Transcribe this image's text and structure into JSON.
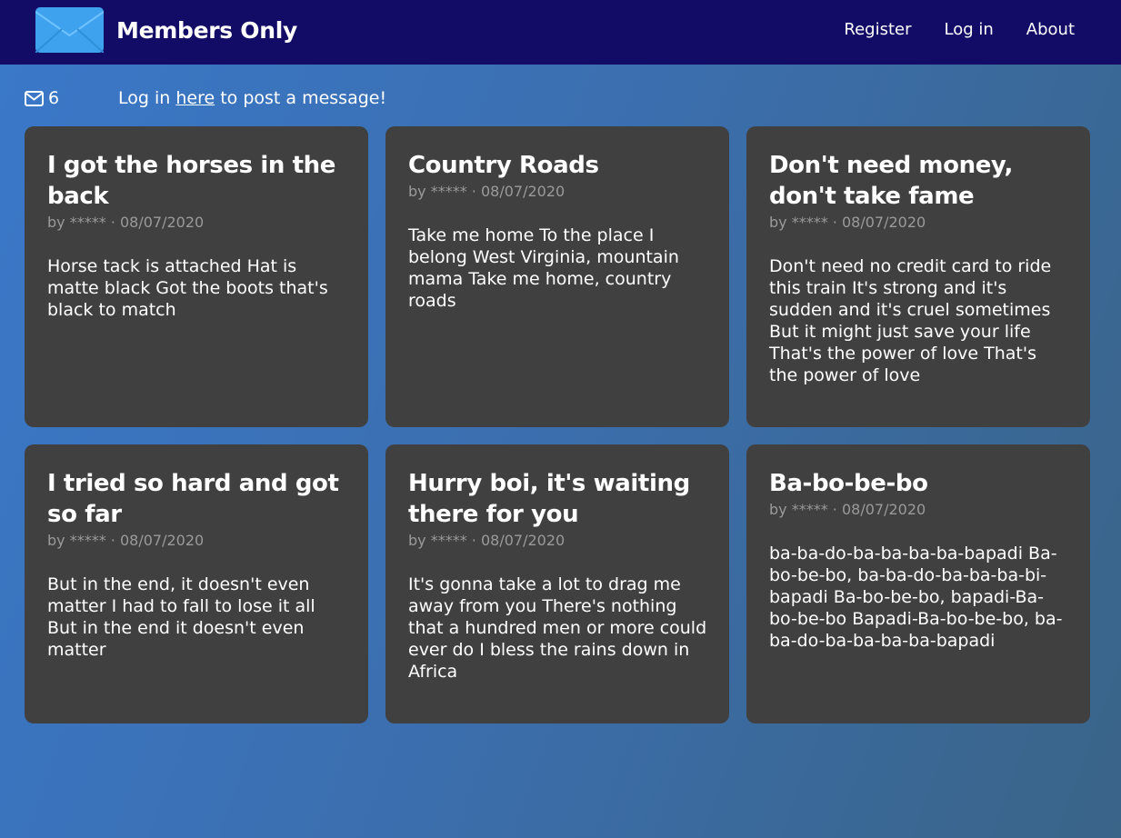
{
  "header": {
    "brand": "Members Only",
    "nav": [
      "Register",
      "Log in",
      "About"
    ]
  },
  "info": {
    "message_count": "6",
    "prompt_before": "Log in ",
    "prompt_link": "here",
    "prompt_after": " to post a message!"
  },
  "messages": [
    {
      "title": "I got the horses in the back",
      "author": "*****",
      "date": "08/07/2020",
      "body": "Horse tack is attached Hat is matte black Got the boots that's black to match"
    },
    {
      "title": "Country Roads",
      "author": "*****",
      "date": "08/07/2020",
      "body": "Take me home To the place I belong West Virginia, mountain mama Take me home, country roads"
    },
    {
      "title": "Don't need money, don't take fame",
      "author": "*****",
      "date": "08/07/2020",
      "body": "Don't need no credit card to ride this train It's strong and it's sudden and it's cruel sometimes But it might just save your life That's the power of love That's the power of love"
    },
    {
      "title": "I tried so hard and got so far",
      "author": "*****",
      "date": "08/07/2020",
      "body": "But in the end, it doesn't even matter I had to fall to lose it all But in the end it doesn't even matter"
    },
    {
      "title": "Hurry boi, it's waiting there for you",
      "author": "*****",
      "date": "08/07/2020",
      "body": "It's gonna take a lot to drag me away from you There's nothing that a hundred men or more could ever do I bless the rains down in Africa"
    },
    {
      "title": "Ba-bo-be-bo",
      "author": "*****",
      "date": "08/07/2020",
      "body": "ba-ba-do-ba-ba-ba-ba-bapadi Ba-bo-be-bo, ba-ba-do-ba-ba-ba-bi-bapadi Ba-bo-be-bo, bapadi-Ba-bo-be-bo Bapadi-Ba-bo-be-bo, ba-ba-do-ba-ba-ba-ba-bapadi"
    }
  ],
  "colors": {
    "navbar": "#120c66",
    "card": "#404040",
    "meta_text": "#9a9a9a",
    "logo_blue": "#3ea2ee"
  },
  "icons": {
    "logo": "envelope-logo-icon",
    "message_count": "envelope-icon"
  }
}
